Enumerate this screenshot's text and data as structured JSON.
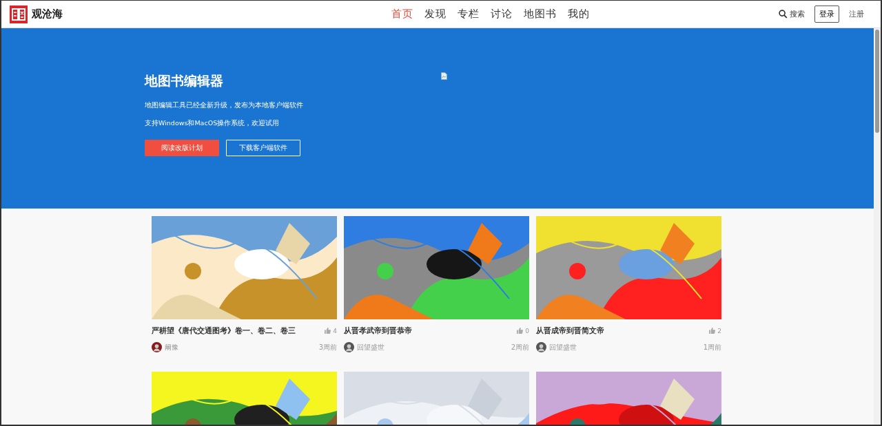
{
  "header": {
    "logo_text": "观沧海",
    "nav": [
      {
        "label": "首页",
        "selected": true
      },
      {
        "label": "发现",
        "selected": false
      },
      {
        "label": "专栏",
        "selected": false
      },
      {
        "label": "讨论",
        "selected": false
      },
      {
        "label": "地图书",
        "selected": false
      },
      {
        "label": "我的",
        "selected": false
      }
    ],
    "search": "搜索",
    "login": "登录",
    "register": "注册"
  },
  "hero": {
    "title": "地图书编辑器",
    "lines": [
      "地图编辑工具已经全新升级，发布为本地客户端软件",
      "支持Windows和MacOS操作系统，欢迎试用"
    ],
    "primary_button": "阅读改版计划",
    "secondary_button": "下载客户端软件"
  },
  "cards": [
    {
      "kind": "picture",
      "title": "严耕望《唐代交通图考》卷一、卷二、卷三",
      "likes": "4",
      "author": "阚豫",
      "time": "3周前"
    },
    {
      "kind": "picture",
      "title": "从晋孝武帝到晋恭帝",
      "likes": "0",
      "author": "回望盛世",
      "time": "2周前"
    },
    {
      "kind": "picture",
      "title": "从晋成帝到晋简文帝",
      "likes": "2",
      "author": "回望盛世",
      "time": "1周前"
    },
    {
      "kind": "picture"
    },
    {
      "kind": "picture"
    },
    {
      "kind": "picture"
    }
  ]
}
